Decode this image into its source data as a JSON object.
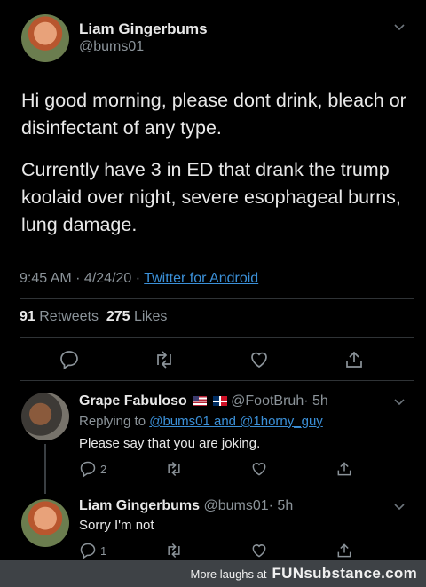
{
  "main_tweet": {
    "author_name": "Liam Gingerbums",
    "author_handle": "@bums01",
    "paragraph1": "Hi good morning, please dont drink, bleach or disinfectant of any type.",
    "paragraph2": "Currently have 3 in ED that drank the trump koolaid over night, severe esophageal burns, lung damage.",
    "time": "9:45 AM · 4/24/20 · ",
    "source": "Twitter for Android",
    "retweets_count": "91",
    "retweets_label": "Retweets",
    "likes_count": "275",
    "likes_label": "Likes"
  },
  "replies": [
    {
      "author_name": "Grape Fabuloso",
      "author_handle": "@FootBruh",
      "time": "· 5h",
      "replying_prefix": "Replying to ",
      "replying_to": "@bums01 and @1horny_guy",
      "text": "Please say that you are joking.",
      "reply_count": "2"
    },
    {
      "author_name": "Liam Gingerbums",
      "author_handle": "@bums01",
      "time": "· 5h",
      "text": "Sorry I'm not",
      "reply_count": "1"
    }
  ],
  "icons": {
    "more": "chevron-down-icon",
    "reply": "comment-icon",
    "retweet": "retweet-icon",
    "like": "heart-icon",
    "share": "share-icon"
  },
  "footer": {
    "prefix": "More laughs at",
    "brand": "FUNsubstance.com"
  },
  "colors": {
    "background": "#000000",
    "link": "#3b90d8",
    "muted": "#8b9399",
    "footer_bg": "#3e4246"
  }
}
